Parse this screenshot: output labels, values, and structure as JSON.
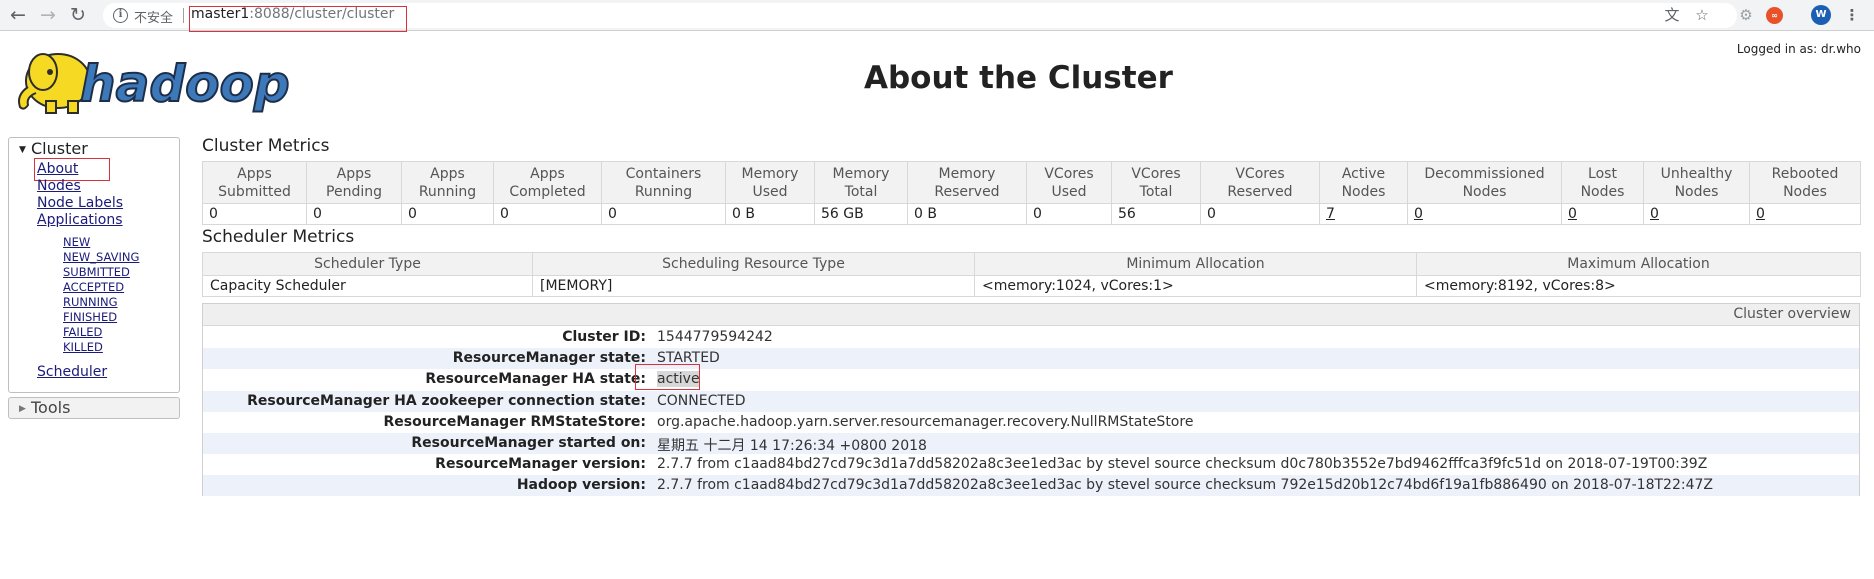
{
  "browser": {
    "security_label": "不安全",
    "url_host": "master1",
    "url_rest": ":8088/cluster/cluster"
  },
  "header": {
    "logged_in": "Logged in as: dr.who",
    "title": "About the Cluster"
  },
  "logo": {
    "text": "hadoop"
  },
  "nav": {
    "cluster_label": "Cluster",
    "about": "About",
    "nodes": "Nodes",
    "node_labels": "Node Labels",
    "applications": "Applications",
    "app_states": [
      "NEW",
      "NEW_SAVING",
      "SUBMITTED",
      "ACCEPTED",
      "RUNNING",
      "FINISHED",
      "FAILED",
      "KILLED"
    ],
    "scheduler": "Scheduler",
    "tools_label": "Tools"
  },
  "cluster_metrics": {
    "title": "Cluster Metrics",
    "headers": [
      [
        "Apps",
        "Submitted"
      ],
      [
        "Apps",
        "Pending"
      ],
      [
        "Apps",
        "Running"
      ],
      [
        "Apps",
        "Completed"
      ],
      [
        "Containers",
        "Running"
      ],
      [
        "Memory",
        "Used"
      ],
      [
        "Memory",
        "Total"
      ],
      [
        "Memory",
        "Reserved"
      ],
      [
        "VCores",
        "Used"
      ],
      [
        "VCores",
        "Total"
      ],
      [
        "VCores",
        "Reserved"
      ],
      [
        "Active",
        "Nodes"
      ],
      [
        "Decommissioned",
        "Nodes"
      ],
      [
        "Lost",
        "Nodes"
      ],
      [
        "Unhealthy",
        "Nodes"
      ],
      [
        "Rebooted",
        "Nodes"
      ]
    ],
    "values": [
      "0",
      "0",
      "0",
      "0",
      "0",
      "0 B",
      "56 GB",
      "0 B",
      "0",
      "56",
      "0",
      "7",
      "0",
      "0",
      "0",
      "0"
    ]
  },
  "scheduler_metrics": {
    "title": "Scheduler Metrics",
    "headers": [
      "Scheduler Type",
      "Scheduling Resource Type",
      "Minimum Allocation",
      "Maximum Allocation"
    ],
    "values": [
      "Capacity Scheduler",
      "[MEMORY]",
      "<memory:1024, vCores:1>",
      "<memory:8192, vCores:8>"
    ]
  },
  "overview": {
    "caption": "Cluster overview",
    "rows": [
      {
        "label": "Cluster ID:",
        "value": "1544779594242"
      },
      {
        "label": "ResourceManager state:",
        "value": "STARTED"
      },
      {
        "label": "ResourceManager HA state:",
        "value": "active"
      },
      {
        "label": "ResourceManager HA zookeeper connection state:",
        "value": "CONNECTED"
      },
      {
        "label": "ResourceManager RMStateStore:",
        "value": "org.apache.hadoop.yarn.server.resourcemanager.recovery.NullRMStateStore"
      },
      {
        "label": "ResourceManager started on:",
        "value": "星期五 十二月 14 17:26:34 +0800 2018"
      },
      {
        "label": "ResourceManager version:",
        "value": "2.7.7 from c1aad84bd27cd79c3d1a7dd58202a8c3ee1ed3ac by stevel source checksum d0c780b3552e7bd9462fffca3f9fc51d on 2018-07-19T00:39Z"
      },
      {
        "label": "Hadoop version:",
        "value": "2.7.7 from c1aad84bd27cd79c3d1a7dd58202a8c3ee1ed3ac by stevel source checksum 792e15d20b12c74bd6f19a1fb886490 on 2018-07-18T22:47Z"
      }
    ]
  },
  "colors": {
    "link": "#1b1b7a",
    "annotation_red": "#d9323b",
    "logo_yellow": "#f5d923",
    "logo_blue": "#3d78b8"
  }
}
